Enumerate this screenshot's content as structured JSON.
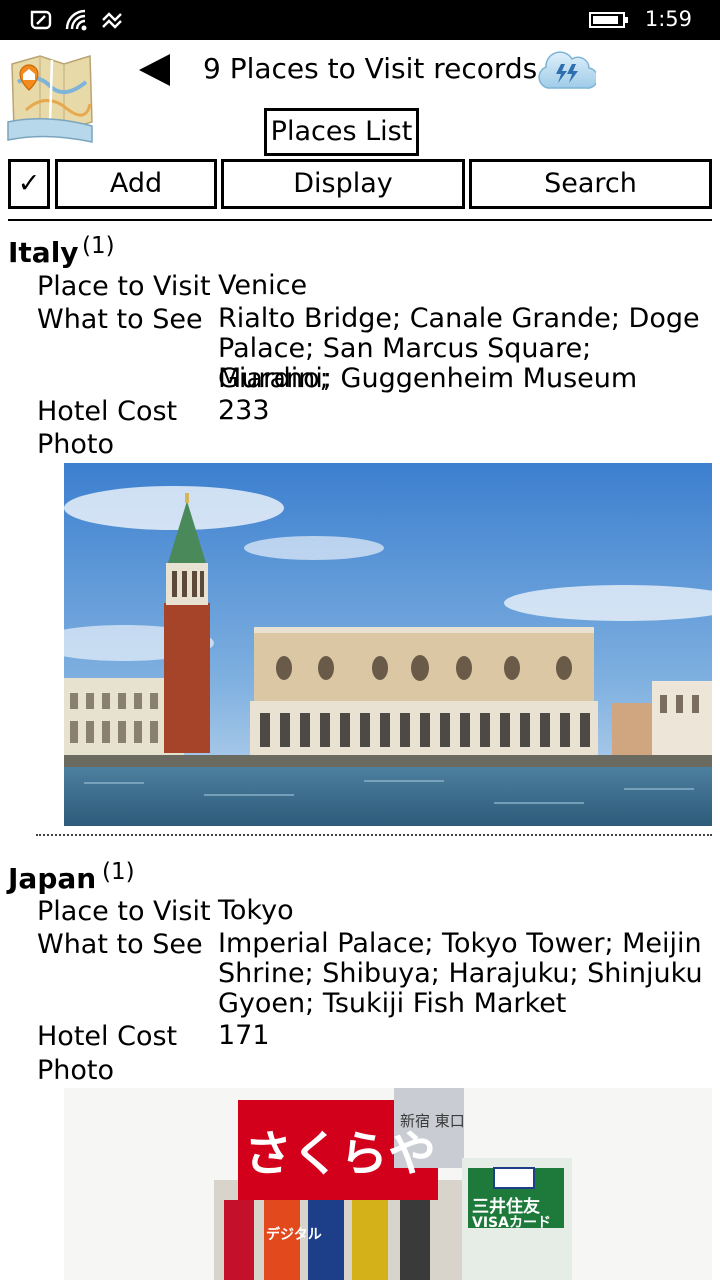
{
  "status_bar": {
    "time": "1:59"
  },
  "header": {
    "title": "9 Places to Visit records",
    "subtitle": "Places List"
  },
  "toolbar": {
    "check_label": "✓",
    "add_label": "Add",
    "display_label": "Display",
    "search_label": "Search"
  },
  "records": [
    {
      "country": "Italy",
      "count": "(1)",
      "place_label": "Place to Visit",
      "place": "Venice",
      "see_label": "What to See",
      "see_lines": [
        "Rialto Bridge; Canale Grande; Doge",
        "Palace; San Marcus Square; Murano;",
        "Giardini; Guggenheim Museum"
      ],
      "cost_label": "Hotel Cost",
      "cost": "233",
      "photo_label": "Photo"
    },
    {
      "country": "Japan",
      "count": "(1)",
      "place_label": "Place to Visit",
      "place": "Tokyo",
      "see_label": "What to See",
      "see_lines": [
        "Imperial Palace; Tokyo Tower; Meijin",
        "Shrine; Shibuya; Harajuku; Shinjuku",
        "Gyoen; Tsukiji Fish Market"
      ],
      "cost_label": "Hotel Cost",
      "cost": "171",
      "photo_label": "Photo",
      "photo_sign_main": "さくらや",
      "photo_sign_small": "三井住友",
      "photo_sign_visa": "VISAカード",
      "photo_sign_top": "新宿 東口",
      "photo_sign_side": "デジタル"
    }
  ]
}
